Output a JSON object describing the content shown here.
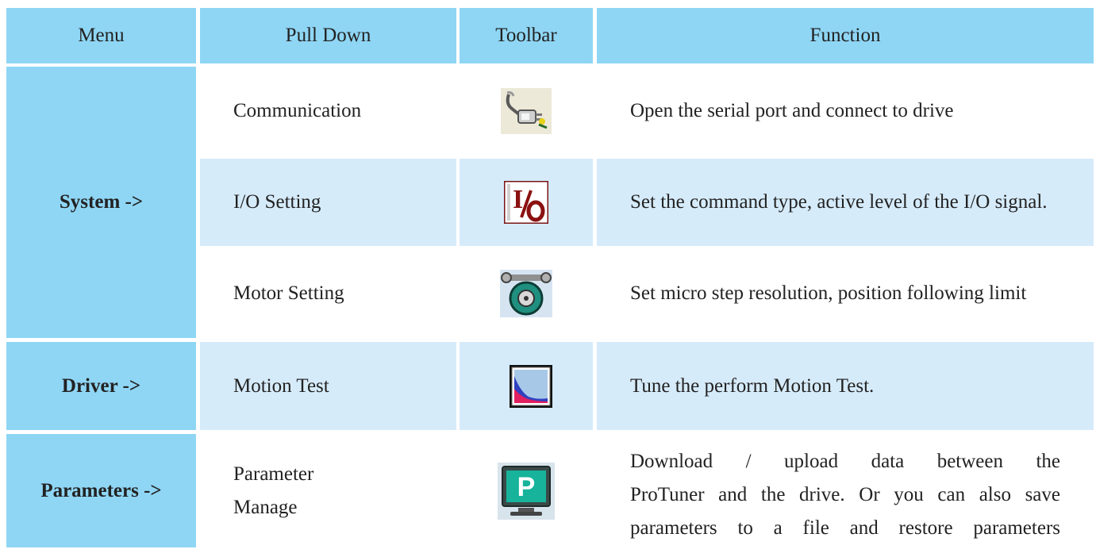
{
  "table": {
    "headers": {
      "menu": "Menu",
      "pull_down": "Pull Down",
      "toolbar": "Toolbar",
      "function": "Function"
    },
    "menus": {
      "system": "System ->",
      "driver": "Driver ->",
      "parameters": "Parameters ->"
    },
    "rows": [
      {
        "pull_down": "Communication",
        "toolbar_icon": "plug-connect-icon",
        "function": "Open the serial port and connect to drive"
      },
      {
        "pull_down": "I/O Setting",
        "toolbar_icon": "io-setting-icon",
        "function": "Set the command type, active level of the I/O signal."
      },
      {
        "pull_down": "Motor Setting",
        "toolbar_icon": "motor-wrench-icon",
        "function": "Set micro step resolution, position following limit"
      },
      {
        "pull_down": "Motion Test",
        "toolbar_icon": "motion-graph-icon",
        "function": "Tune the perform Motion Test."
      },
      {
        "pull_down_lines": [
          "Parameter",
          "Manage"
        ],
        "toolbar_icon": "parameter-monitor-icon",
        "function_lines": [
          "Download / upload data between the",
          "ProTuner and the drive. Or you can also save",
          "parameters to a file and restore parameters"
        ]
      }
    ],
    "colors": {
      "header_bg": "#8fd6f5",
      "row_alt_bg": "#d6ebfa",
      "row_bg": "#ffffff"
    }
  }
}
